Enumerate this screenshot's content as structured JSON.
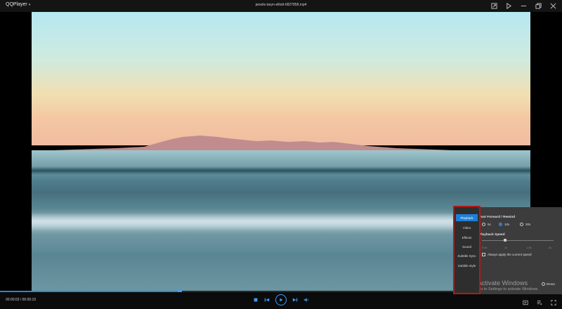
{
  "titlebar": {
    "app_name": "QQPlayer",
    "file_name": "pexels-taryn-elliott-6827858.mp4",
    "icons": [
      "screenshot-icon",
      "playlist-icon",
      "minimize-icon",
      "restore-icon",
      "close-icon"
    ]
  },
  "playback": {
    "time": "00:00:03 / 00:00:10",
    "progress_fraction": 0.32
  },
  "controls": {
    "transport": [
      "stop-icon",
      "previous-icon",
      "play-icon",
      "next-icon",
      "volume-icon"
    ],
    "right": [
      "settings-icon",
      "playlist-toggle-icon",
      "fullscreen-icon"
    ]
  },
  "settings": {
    "menu": [
      "Playback",
      "Video",
      "Effects",
      "Sound",
      "Subtitle Sync",
      "Subtitle style"
    ],
    "active_menu": "Playback",
    "fast_forward_title": "Fast Forward / Rewind",
    "ff_options": [
      "5s",
      "10s",
      "30s"
    ],
    "ff_selected": "10s",
    "speed_title": "Playback Speed",
    "speed_ticks": [
      "0.5x",
      "1x",
      "1.5x",
      "2x"
    ],
    "speed_value": "1x",
    "always_apply_label": "Always apply the current speed",
    "always_apply_checked": false,
    "reset_label": "Reset"
  },
  "watermark": {
    "title": "Activate Windows",
    "subtitle": "Go to Settings to activate Windows."
  },
  "colors": {
    "accent": "#2d87d6",
    "highlight_border": "#b01a1a"
  }
}
